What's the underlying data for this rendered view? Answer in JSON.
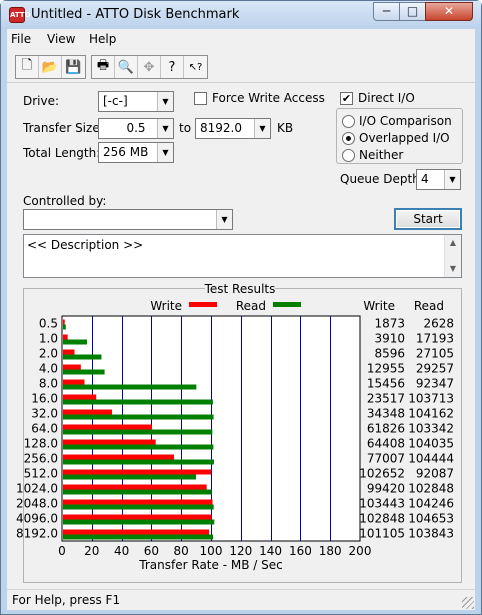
{
  "window": {
    "title": "Untitled - ATTO Disk Benchmark",
    "icon_text": "ATTO",
    "minimize": "─",
    "maximize": "□",
    "close": "✕"
  },
  "menu": [
    "File",
    "View",
    "Help"
  ],
  "toolbar": [
    "new-icon",
    "open-icon",
    "save-icon",
    "print-icon",
    "print-preview-icon",
    "move-icon",
    "help-icon",
    "context-help-icon"
  ],
  "toolbar_glyphs": [
    "🗋",
    "📂",
    "💾",
    "🖶",
    "🔍",
    "✥",
    "?",
    "↖?"
  ],
  "form": {
    "drive_label": "Drive:",
    "drive_value": "[-c-]",
    "force_write_label": "Force Write Access",
    "force_write_checked": false,
    "direct_io_label": "Direct I/O",
    "direct_io_checked": true,
    "transfer_size_label": "Transfer Size:",
    "transfer_from": "0.5",
    "transfer_to_label": "to",
    "transfer_to": "8192.0",
    "transfer_unit": "KB",
    "total_length_label": "Total Length:",
    "total_length_value": "256 MB",
    "io_options": [
      "I/O Comparison",
      "Overlapped I/O",
      "Neither"
    ],
    "io_selected": "Overlapped I/O",
    "queue_depth_label": "Queue Depth:",
    "queue_depth_value": "4",
    "controlled_by_label": "Controlled by:",
    "controlled_by_value": "",
    "start_label": "Start",
    "description": "<< Description >>"
  },
  "results": {
    "title": "Test Results",
    "legend_write": "Write",
    "legend_read": "Read",
    "col_write": "Write",
    "col_read": "Read"
  },
  "chart_data": {
    "type": "bar",
    "orientation": "horizontal",
    "categories": [
      "0.5",
      "1.0",
      "2.0",
      "4.0",
      "8.0",
      "16.0",
      "32.0",
      "64.0",
      "128.0",
      "256.0",
      "512.0",
      "1024.0",
      "2048.0",
      "4096.0",
      "8192.0"
    ],
    "series": [
      {
        "name": "Write",
        "color": "#ff0000",
        "values": [
          1873,
          3910,
          8596,
          12955,
          15456,
          23517,
          34348,
          61826,
          64408,
          77007,
          102652,
          99420,
          103443,
          102848,
          101105
        ]
      },
      {
        "name": "Read",
        "color": "#007f00",
        "values": [
          2628,
          17193,
          27105,
          29257,
          92347,
          103713,
          104162,
          103342,
          104035,
          104444,
          92087,
          102848,
          104246,
          104653,
          103843
        ]
      }
    ],
    "xlabel": "Transfer Rate - MB / Sec",
    "xticks": [
      0,
      20,
      40,
      60,
      80,
      100,
      120,
      140,
      160,
      180,
      200
    ],
    "xlim": [
      0,
      200
    ],
    "unit_scale": 1024,
    "grid": true,
    "gridline_color": "#0000aa"
  },
  "status": "For Help, press F1"
}
